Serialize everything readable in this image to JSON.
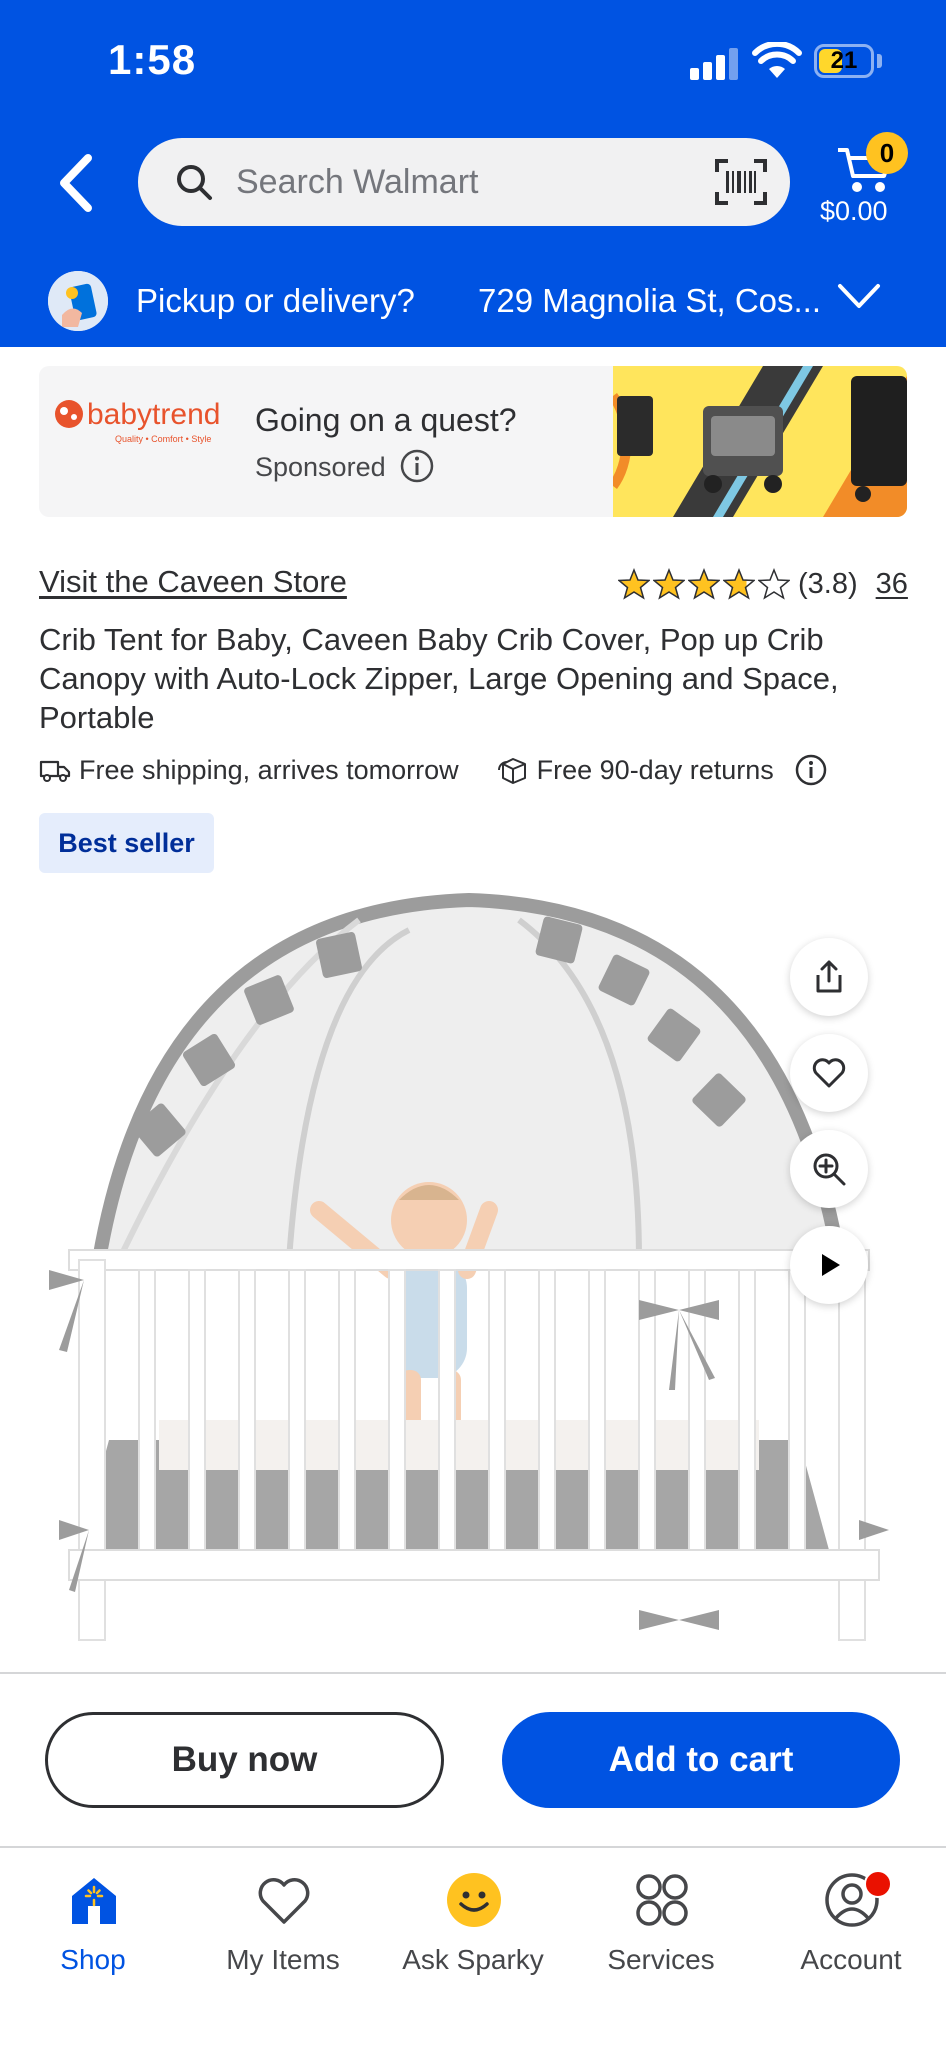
{
  "status_bar": {
    "time": "1:58",
    "battery": "21"
  },
  "header": {
    "search_placeholder": "Search Walmart",
    "cart": {
      "count": "0",
      "total": "$0.00"
    },
    "pickup": {
      "label": "Pickup or delivery?",
      "address": "729 Magnolia St, Cos..."
    }
  },
  "ad": {
    "brand": "babytrend",
    "brand_tagline": "Quality • Comfort • Style",
    "title": "Going on a quest?",
    "sponsored": "Sponsored"
  },
  "product": {
    "store_link": "Visit the Caveen Store",
    "rating": 3.8,
    "rating_text": "(3.8)",
    "review_count": "36",
    "title": "Crib Tent for Baby, Caveen Baby Crib Cover, Pop up Crib Canopy with Auto-Lock Zipper, Large Opening and Space, Portable",
    "shipping": "Free shipping, arrives tomorrow",
    "returns": "Free 90-day returns",
    "badge": "Best seller"
  },
  "actions": {
    "buy_now": "Buy now",
    "add_to_cart": "Add to cart"
  },
  "tabs": [
    {
      "label": "Shop",
      "icon": "shop-icon",
      "active": true
    },
    {
      "label": "My Items",
      "icon": "heart-icon",
      "active": false
    },
    {
      "label": "Ask Sparky",
      "icon": "sparky-icon",
      "active": false
    },
    {
      "label": "Services",
      "icon": "services-icon",
      "active": false
    },
    {
      "label": "Account",
      "icon": "account-icon",
      "active": false
    }
  ],
  "colors": {
    "brand_blue": "#0053e2",
    "spark_yellow": "#ffc220",
    "badge_bg": "#e5edfc",
    "notification_red": "#ea1100"
  }
}
